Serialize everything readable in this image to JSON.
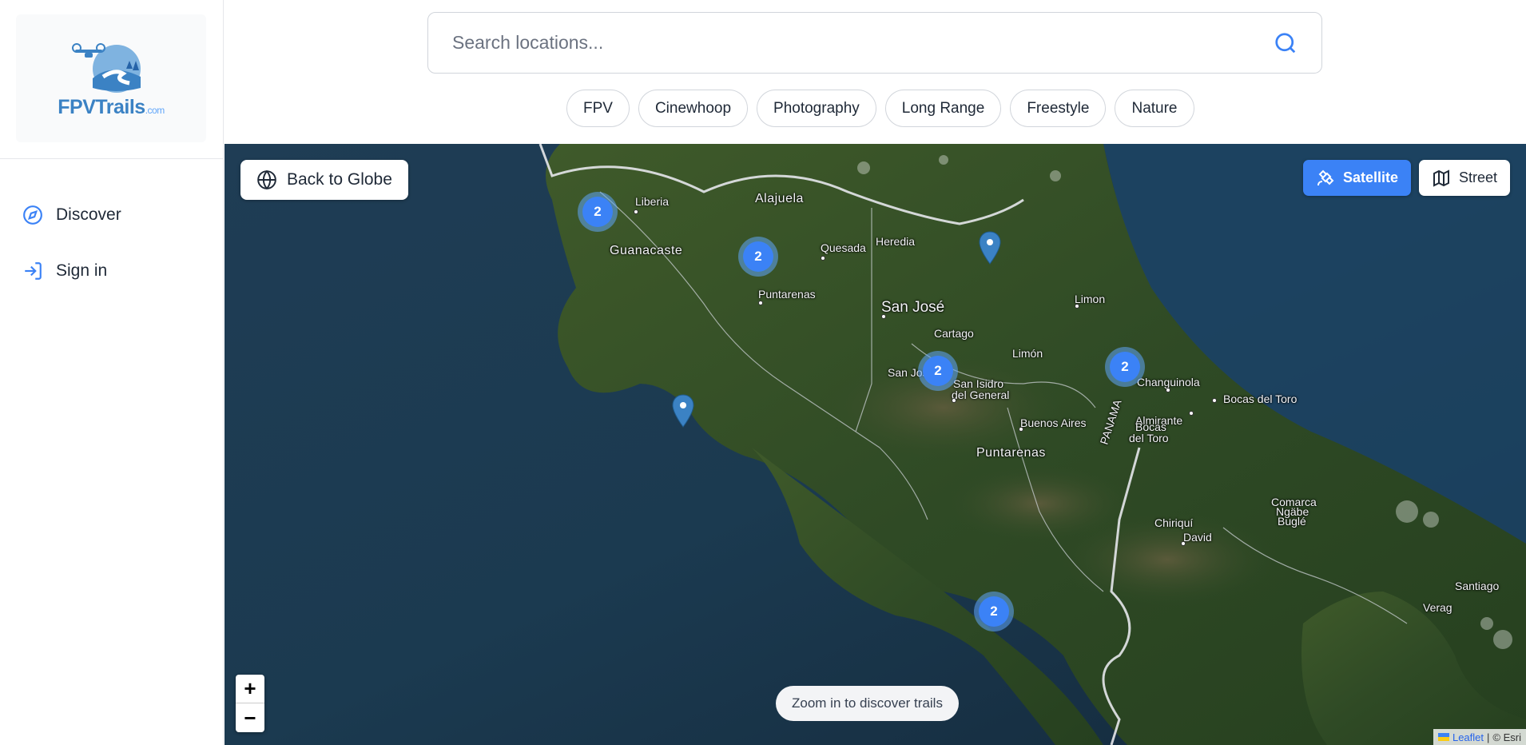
{
  "brand": {
    "name": "FPVTrails",
    "suffix": ".com"
  },
  "nav": {
    "items": [
      {
        "label": "Discover",
        "icon": "compass-icon"
      },
      {
        "label": "Sign in",
        "icon": "sign-in-icon"
      }
    ]
  },
  "search": {
    "placeholder": "Search locations...",
    "value": ""
  },
  "filters": [
    "FPV",
    "Cinewhoop",
    "Photography",
    "Long Range",
    "Freestyle",
    "Nature"
  ],
  "map": {
    "back_label": "Back to Globe",
    "layers": {
      "satellite": "Satellite",
      "street": "Street",
      "active": "satellite"
    },
    "zoom_in": "+",
    "zoom_out": "−",
    "hint": "Zoom in to discover trails",
    "attribution": {
      "leaflet": "Leaflet",
      "separator": "|",
      "source": "© Esri"
    },
    "clusters": [
      "2",
      "2",
      "2",
      "2",
      "2"
    ],
    "places": [
      "Liberia",
      "Alajuela",
      "Guanacaste",
      "Quesada",
      "Heredia",
      "Puntarenas",
      "San José",
      "Limon",
      "Cartago",
      "Limón",
      "San José",
      "San Isidro",
      "del General",
      "Changuinola",
      "Bocas del Toro",
      "Almirante",
      "Bocas",
      "del Toro",
      "PANAMA",
      "Buenos Aires",
      "Puntarenas",
      "Chiriquí",
      "David",
      "Comarca",
      "Ngäbe",
      "Buglé",
      "Santiago",
      "Verag"
    ]
  },
  "colors": {
    "accent": "#3b82f6",
    "brand": "#3b82c4"
  }
}
